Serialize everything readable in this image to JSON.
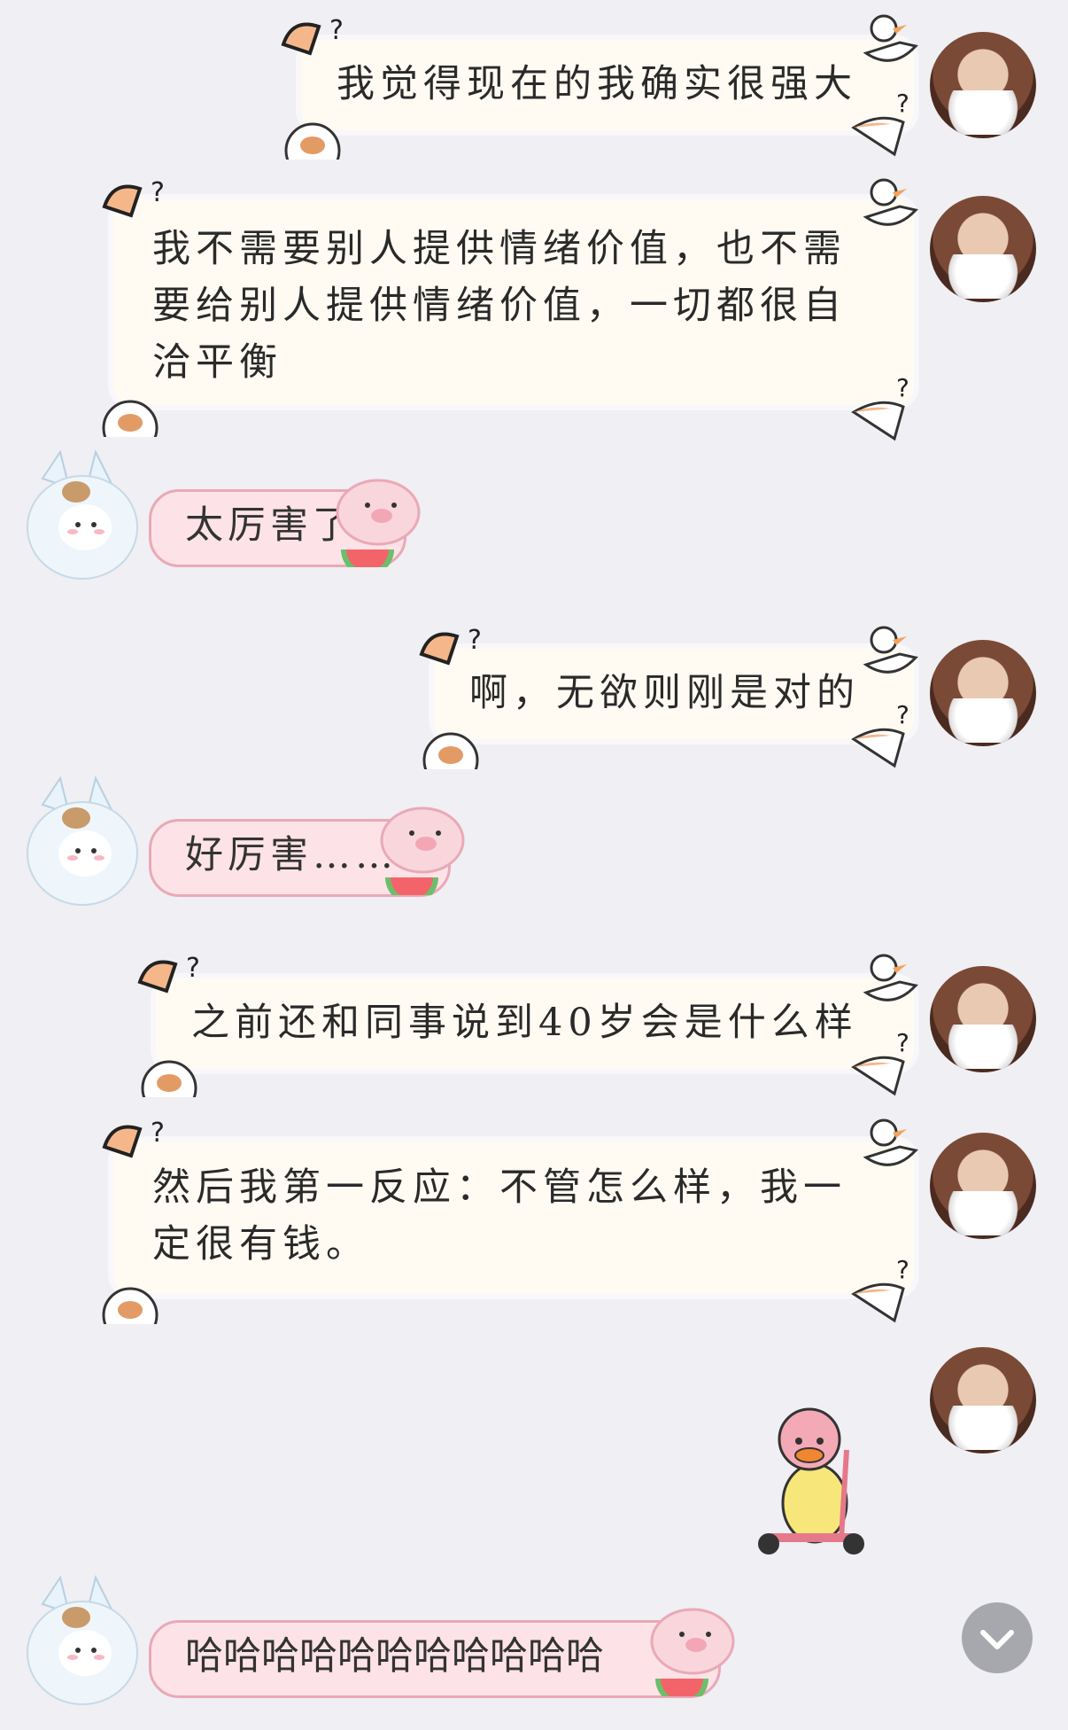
{
  "messages": [
    {
      "side": "right",
      "text": "我觉得现在的我确实很强大"
    },
    {
      "side": "right",
      "text": "我不需要别人提供情绪价值，也不需要给别人提供情绪价值，一切都很自洽平衡"
    },
    {
      "side": "left",
      "text": "太厉害了"
    },
    {
      "side": "right",
      "text": "啊，无欲则刚是对的"
    },
    {
      "side": "left",
      "text": "好厉害……"
    },
    {
      "side": "right",
      "text": "之前还和同事说到40岁会是什么样"
    },
    {
      "side": "right",
      "text": "然后我第一反应：不管怎么样，我一定很有钱。"
    },
    {
      "side": "right",
      "sticker": "duck-on-scooter"
    },
    {
      "side": "left",
      "text": "哈哈哈哈哈哈哈哈哈哈哈"
    }
  ],
  "colors": {
    "background": "#efeff4",
    "right_bubble": "#fffbf3",
    "left_bubble": "#fde3e7",
    "left_border": "#e9a9b7",
    "scroll_button": "#a6a8ad"
  },
  "icons": {
    "scroll": "chevron-down-icon",
    "duck": "duck-doodle-icon",
    "bear": "bear-doodle-icon",
    "pig": "pig-doodle-icon",
    "watermelon": "watermelon-icon"
  }
}
